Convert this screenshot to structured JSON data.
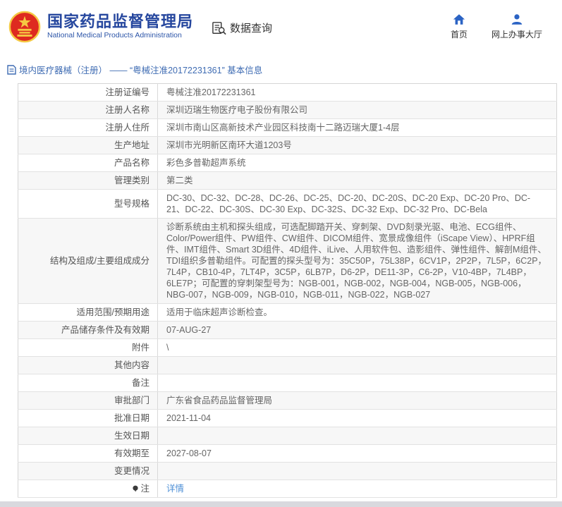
{
  "header": {
    "site_title": "国家药品监督管理局",
    "site_subtitle": "National Medical Products Administration",
    "section_title": "数据查询",
    "nav": [
      {
        "icon": "home-icon",
        "label": "首页"
      },
      {
        "icon": "person-icon",
        "label": "网上办事大厅"
      }
    ]
  },
  "breadcrumb": {
    "icon": "document-icon",
    "text": "境内医疗器械（注册） —— “粤械注准20172231361” 基本信息"
  },
  "table": {
    "rows": [
      {
        "label": "注册证编号",
        "value": "粤械注准20172231361"
      },
      {
        "label": "注册人名称",
        "value": "深圳迈瑞生物医疗电子股份有限公司"
      },
      {
        "label": "注册人住所",
        "value": "深圳市南山区高新技术产业园区科技南十二路迈瑞大厦1-4层"
      },
      {
        "label": "生产地址",
        "value": "深圳市光明新区南环大道1203号"
      },
      {
        "label": "产品名称",
        "value": "彩色多普勒超声系统"
      },
      {
        "label": "管理类别",
        "value": "第二类"
      },
      {
        "label": "型号规格",
        "value": "DC-30、DC-32、DC-28、DC-26、DC-25、DC-20、DC-20S、DC-20 Exp、DC-20 Pro、DC-21、DC-22、DC-30S、DC-30 Exp、DC-32S、DC-32 Exp、DC-32 Pro、DC-Bela"
      },
      {
        "label": "结构及组成/主要组成成分",
        "value": "诊断系统由主机和探头组成，可选配脚踏开关、穿刺架、DVD刻录光驱、电池、ECG组件、Color/Power组件、PW组件、CW组件、DICOM组件、宽景成像组件（iScape View）、HPRF组件、IMT组件、Smart 3D组件、4D组件、iLive、人用软件包、造影组件、弹性组件、解剖M组件、TDI组织多普勒组件。可配置的探头型号为：35C50P，75L38P，6CV1P，2P2P，7L5P，6C2P，7L4P，CB10-4P，7LT4P，3C5P，6LB7P，D6-2P，DE11-3P，C6-2P，V10-4BP，7L4BP，6LE7P；可配置的穿刺架型号为：NGB-001，NGB-002，NGB-004，NGB-005，NGB-006，NBG-007，NGB-009，NGB-010，NGB-011，NGB-022，NGB-027"
      },
      {
        "label": "适用范围/预期用途",
        "value": "适用于临床超声诊断检查。"
      },
      {
        "label": "产品储存条件及有效期",
        "value": "07-AUG-27"
      },
      {
        "label": "附件",
        "value": "\\"
      },
      {
        "label": "其他内容",
        "value": ""
      },
      {
        "label": "备注",
        "value": ""
      },
      {
        "label": "审批部门",
        "value": "广东省食品药品监督管理局"
      },
      {
        "label": "批准日期",
        "value": "2021-11-04"
      },
      {
        "label": "生效日期",
        "value": ""
      },
      {
        "label": "有效期至",
        "value": "2027-08-07"
      },
      {
        "label": "变更情况",
        "value": ""
      },
      {
        "label": "注",
        "value": "详情",
        "link": true,
        "icon": "note-icon"
      }
    ]
  },
  "colors": {
    "brand_blue": "#26479e",
    "icon_blue": "#2b63c4",
    "breadcrumb_blue": "#3f6cb3",
    "link_blue": "#4d8fd6",
    "emblem_red": "#de2a20",
    "emblem_gold": "#f5c842",
    "zebra_gray": "#f7f7f7",
    "border_gray": "#d5d5d5"
  }
}
